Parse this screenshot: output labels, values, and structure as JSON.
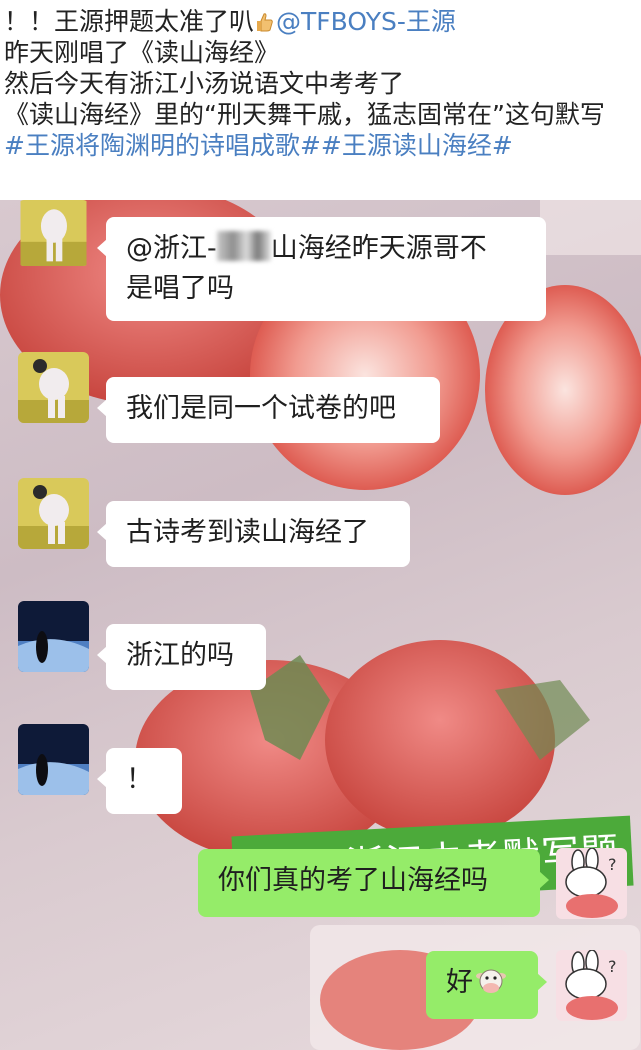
{
  "caption": {
    "line1_prefix": "！！王源押题太准了叭",
    "line1_mention": "@TFBOYS-王源",
    "line2": "昨天刚唱了《读山海经》",
    "line3": "然后今天有浙江小汤说语文中考考了",
    "line4": "《读山海经》里的“刑天舞干戚，猛志固常在”这句默写",
    "line5_tag1": "#王源将陶渊明的诗唱成歌#",
    "line5_tag2": "#王源读山海经#"
  },
  "chat": {
    "messages": [
      {
        "side": "in",
        "text_a": "@浙江-",
        "text_b": "山海经昨天源哥不",
        "text_c": "是唱了吗"
      },
      {
        "side": "in",
        "text": "我们是同一个试卷的吧"
      },
      {
        "side": "in",
        "text": "古诗考到读山海经了"
      },
      {
        "side": "in",
        "text": "浙江的吗"
      },
      {
        "side": "in",
        "text": "！"
      },
      {
        "side": "out",
        "text": "你们真的考了山海经吗"
      },
      {
        "side": "out",
        "text": "好"
      }
    ],
    "stamp": "2020浙江中考默写题"
  },
  "colors": {
    "link": "#4a7fc1",
    "outgoing_bubble": "#95ec69",
    "stamp_bg": "#4caa3a"
  },
  "icons": {
    "line1": "thumbs-up-icon",
    "reply": "cow-face-icon"
  }
}
